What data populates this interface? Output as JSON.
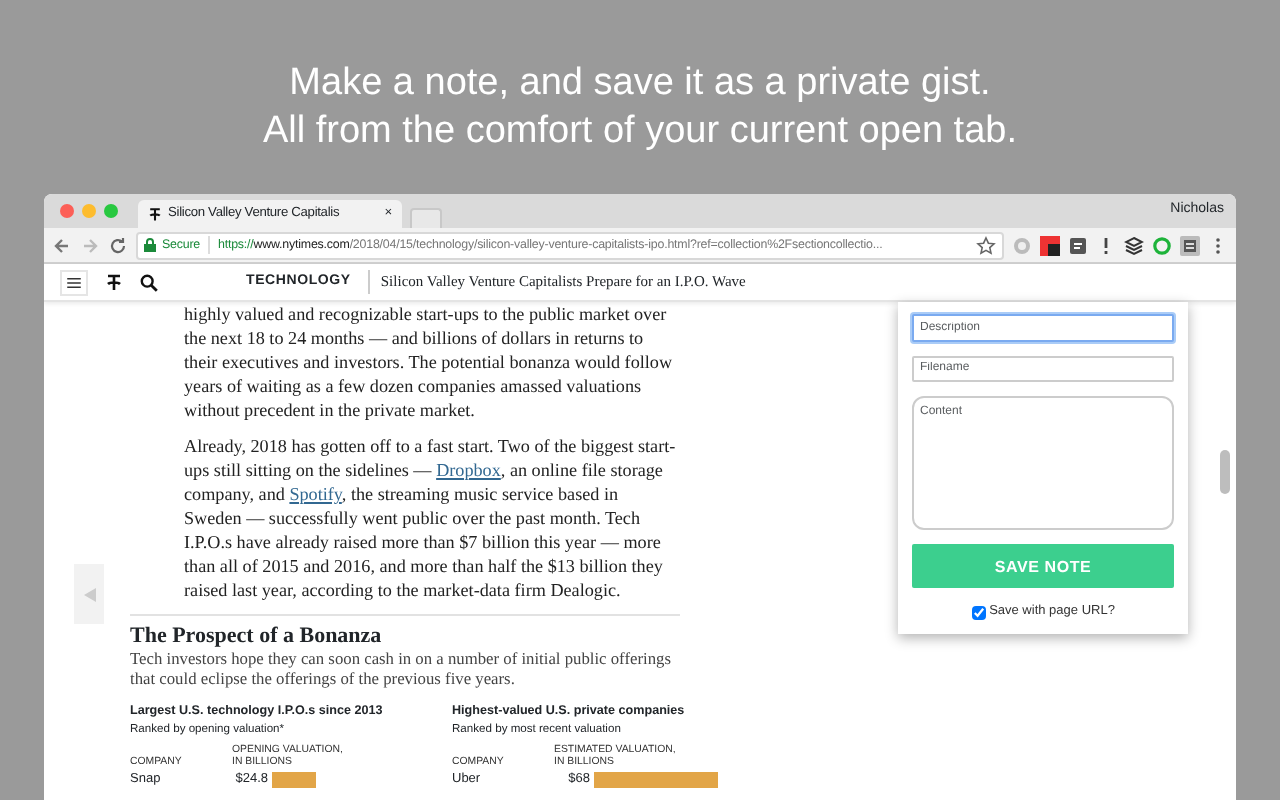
{
  "headline": [
    "Make a note, and save it as a private gist.",
    "All from the comfort of your current open tab."
  ],
  "browser": {
    "tab_title": "Silicon Valley Venture Capitalis",
    "tab_close": "×",
    "profile": "Nicholas",
    "secure_label": "Secure",
    "url_scheme": "https://",
    "url_host": "www.nytimes.com",
    "url_path": "/2018/04/15/technology/silicon-valley-venture-capitalists-ipo.html?ref=collection%2Fsectioncollectio..."
  },
  "site_header": {
    "section": "TECHNOLOGY",
    "headline": "Silicon Valley Venture Capitalists Prepare for an I.P.O. Wave"
  },
  "article": {
    "paragraphs": [
      [
        {
          "text": "highly valued and recognizable start-ups to the public market over the next 18 to 24 months — and billions of dollars in returns to their executives and investors. The potential bonanza would follow years of waiting as a few dozen companies amassed valuations without precedent in the private market."
        }
      ],
      [
        {
          "text": "Already, 2018 has gotten off to a fast start. Two of the biggest start-ups still sitting on the sidelines — "
        },
        {
          "text": "Dropbox",
          "kind": "link"
        },
        {
          "text": ", an online file storage company, and "
        },
        {
          "text": "Spotify",
          "kind": "link"
        },
        {
          "text": ", the streaming music service based in Sweden — successfully went public over the past month. Tech I.P.O.s have already raised more than $7 billion this year — more than all of 2015 and 2016, and more than half the $13 billion they raised last year, according to the market-data firm Dealogic."
        }
      ]
    ]
  },
  "graphic": {
    "title": "The Prospect of a Bonanza",
    "dek": "Tech investors hope they can soon cash in on a number of initial public offerings that could eclipse the offerings of the previous five years.",
    "charts": [
      {
        "title": "Largest U.S. technology I.P.O.s since 2013",
        "subtitle": "Ranked by opening valuation*",
        "company_column": "COMPANY",
        "value_column": [
          "OPENING VALUATION,",
          "IN BILLIONS"
        ],
        "rows": [
          {
            "company": "Snap",
            "value": "$24.8",
            "level": 0.35
          }
        ]
      },
      {
        "title": "Highest-valued U.S. private companies",
        "subtitle": "Ranked by most recent valuation",
        "company_column": "COMPANY",
        "value_column": [
          "ESTIMATED VALUATION,",
          "IN BILLIONS"
        ],
        "rows": [
          {
            "company": "Uber",
            "value": "$68",
            "level": 0.97
          }
        ]
      }
    ]
  },
  "popup": {
    "fields": [
      {
        "placeholder": "Description",
        "focused": true
      },
      {
        "placeholder": "Filename",
        "focused": false
      }
    ],
    "content_placeholder": "Content",
    "button": "SAVE NOTE",
    "save_with_url": {
      "label": "Save with page URL?",
      "checked": true
    }
  }
}
